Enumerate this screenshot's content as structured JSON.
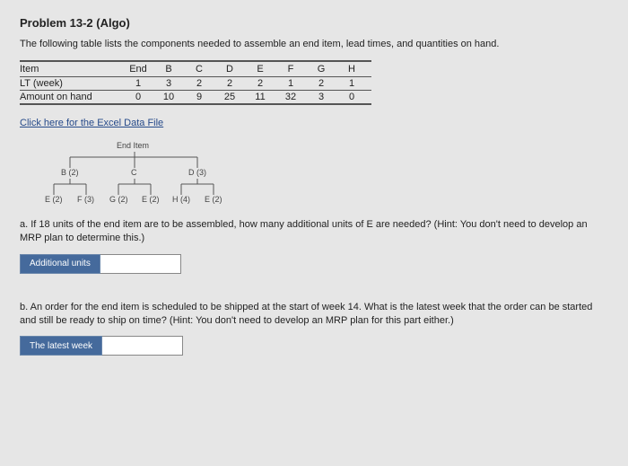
{
  "title": "Problem 13-2 (Algo)",
  "intro": "The following table lists the components needed to assemble an end item, lead times, and quantities on hand.",
  "table": {
    "row0": {
      "lbl": "Item",
      "c0": "End",
      "c1": "B",
      "c2": "C",
      "c3": "D",
      "c4": "E",
      "c5": "F",
      "c6": "G",
      "c7": "H"
    },
    "row1": {
      "lbl": "LT (week)",
      "c0": "1",
      "c1": "3",
      "c2": "2",
      "c3": "2",
      "c4": "2",
      "c5": "1",
      "c6": "2",
      "c7": "1"
    },
    "row2": {
      "lbl": "Amount on hand",
      "c0": "0",
      "c1": "10",
      "c2": "9",
      "c3": "25",
      "c4": "11",
      "c5": "32",
      "c6": "3",
      "c7": "0"
    }
  },
  "link_text": "Click here for the Excel Data File",
  "tree": {
    "top": "End Item",
    "l1a": "B (2)",
    "l1b": "C",
    "l1c": "D (3)",
    "l2a": "E (2)",
    "l2b": "F (3)",
    "l2c": "G (2)",
    "l2d": "E (2)",
    "l2e": "H (4)",
    "l2f": "E (2)"
  },
  "qa": {
    "text": "a. If 18 units of the end item are to be assembled, how many additional units of E are needed? (Hint: You don't need to develop an MRP plan to determine this.)",
    "label": "Additional units"
  },
  "qb": {
    "text": "b. An order for the end item is scheduled to be shipped at the start of week 14. What is the latest week that the order can be started and still be ready to ship on time? (Hint: You don't need to develop an MRP plan for this part either.)",
    "label": "The latest week"
  }
}
